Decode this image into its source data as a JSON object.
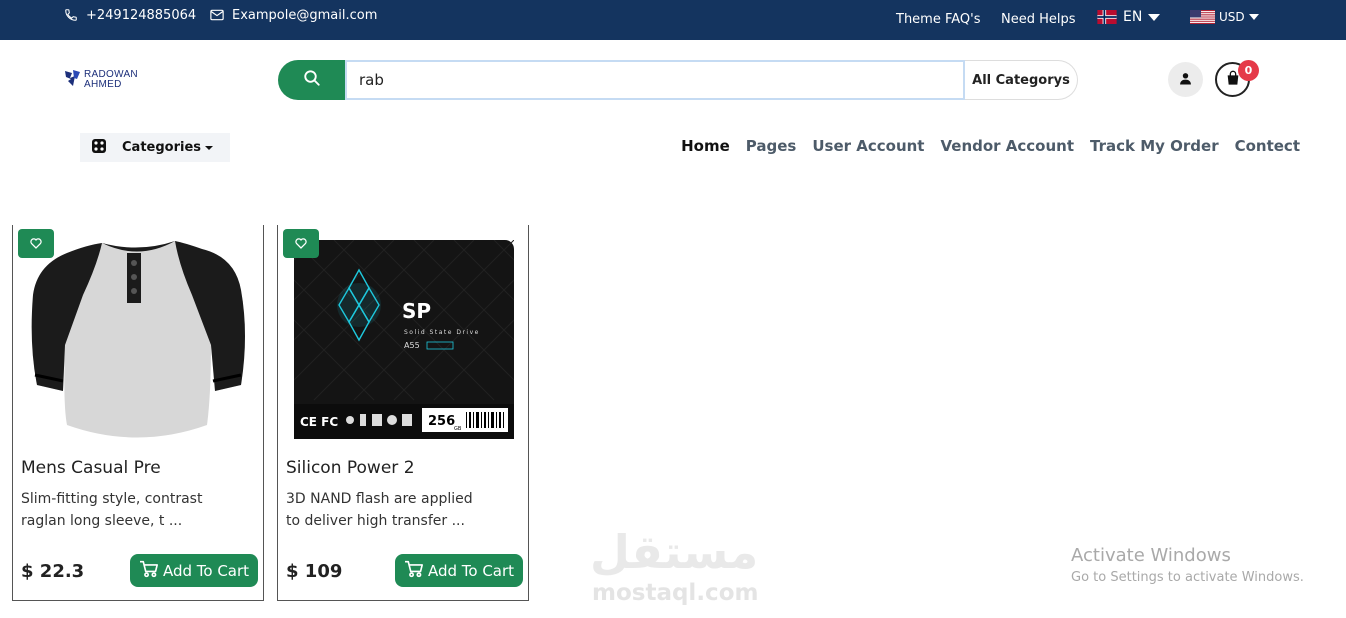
{
  "topbar": {
    "phone": "+249124885064",
    "email": "Exampole@gmail.com",
    "links": [
      "Theme FAQ's",
      "Need Helps"
    ],
    "language": "EN",
    "currency": "USD",
    "bg_color": "#14345f"
  },
  "header": {
    "logo_line1": "RADOWAN",
    "logo_line2": "AHMED",
    "search_value": "rab",
    "category_select": "All Categorys",
    "cart_count": "0",
    "accent_color": "#1f8a55"
  },
  "nav": {
    "categories_label": "Categories",
    "items": [
      "Home",
      "Pages",
      "User Account",
      "Vendor Account",
      "Track My Order",
      "Contect"
    ],
    "active": "Home"
  },
  "products": [
    {
      "name": "Mens Casual Pre",
      "description": "Slim-fitting style, contrast raglan long sleeve, t ...",
      "price": "$ 22.3",
      "button": "Add To Cart",
      "image_icon": "raglan-shirt-image"
    },
    {
      "name": "Silicon Power 2",
      "description": "3D NAND flash are applied to deliver high transfer ...",
      "price": "$ 109",
      "button": "Add To Cart",
      "image_icon": "ssd-drive-image",
      "image_text": {
        "brand": "SP",
        "line": "Solid State Drive",
        "model": "A55",
        "capacity": "256",
        "unit": "GB"
      }
    }
  ],
  "overlay": {
    "watermark_ar": "مستقل",
    "watermark_en": "mostaql.com",
    "activate_title": "Activate Windows",
    "activate_sub": "Go to Settings to activate Windows."
  }
}
